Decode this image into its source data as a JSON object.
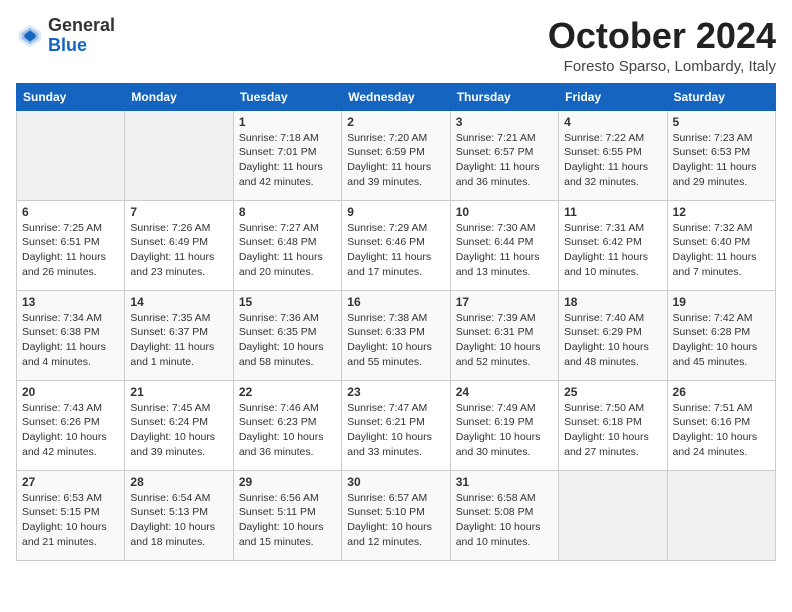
{
  "logo": {
    "general": "General",
    "blue": "Blue"
  },
  "title": "October 2024",
  "location": "Foresto Sparso, Lombardy, Italy",
  "days_header": [
    "Sunday",
    "Monday",
    "Tuesday",
    "Wednesday",
    "Thursday",
    "Friday",
    "Saturday"
  ],
  "weeks": [
    [
      {
        "day": "",
        "info": ""
      },
      {
        "day": "",
        "info": ""
      },
      {
        "day": "1",
        "info": "Sunrise: 7:18 AM\nSunset: 7:01 PM\nDaylight: 11 hours and 42 minutes."
      },
      {
        "day": "2",
        "info": "Sunrise: 7:20 AM\nSunset: 6:59 PM\nDaylight: 11 hours and 39 minutes."
      },
      {
        "day": "3",
        "info": "Sunrise: 7:21 AM\nSunset: 6:57 PM\nDaylight: 11 hours and 36 minutes."
      },
      {
        "day": "4",
        "info": "Sunrise: 7:22 AM\nSunset: 6:55 PM\nDaylight: 11 hours and 32 minutes."
      },
      {
        "day": "5",
        "info": "Sunrise: 7:23 AM\nSunset: 6:53 PM\nDaylight: 11 hours and 29 minutes."
      }
    ],
    [
      {
        "day": "6",
        "info": "Sunrise: 7:25 AM\nSunset: 6:51 PM\nDaylight: 11 hours and 26 minutes."
      },
      {
        "day": "7",
        "info": "Sunrise: 7:26 AM\nSunset: 6:49 PM\nDaylight: 11 hours and 23 minutes."
      },
      {
        "day": "8",
        "info": "Sunrise: 7:27 AM\nSunset: 6:48 PM\nDaylight: 11 hours and 20 minutes."
      },
      {
        "day": "9",
        "info": "Sunrise: 7:29 AM\nSunset: 6:46 PM\nDaylight: 11 hours and 17 minutes."
      },
      {
        "day": "10",
        "info": "Sunrise: 7:30 AM\nSunset: 6:44 PM\nDaylight: 11 hours and 13 minutes."
      },
      {
        "day": "11",
        "info": "Sunrise: 7:31 AM\nSunset: 6:42 PM\nDaylight: 11 hours and 10 minutes."
      },
      {
        "day": "12",
        "info": "Sunrise: 7:32 AM\nSunset: 6:40 PM\nDaylight: 11 hours and 7 minutes."
      }
    ],
    [
      {
        "day": "13",
        "info": "Sunrise: 7:34 AM\nSunset: 6:38 PM\nDaylight: 11 hours and 4 minutes."
      },
      {
        "day": "14",
        "info": "Sunrise: 7:35 AM\nSunset: 6:37 PM\nDaylight: 11 hours and 1 minute."
      },
      {
        "day": "15",
        "info": "Sunrise: 7:36 AM\nSunset: 6:35 PM\nDaylight: 10 hours and 58 minutes."
      },
      {
        "day": "16",
        "info": "Sunrise: 7:38 AM\nSunset: 6:33 PM\nDaylight: 10 hours and 55 minutes."
      },
      {
        "day": "17",
        "info": "Sunrise: 7:39 AM\nSunset: 6:31 PM\nDaylight: 10 hours and 52 minutes."
      },
      {
        "day": "18",
        "info": "Sunrise: 7:40 AM\nSunset: 6:29 PM\nDaylight: 10 hours and 48 minutes."
      },
      {
        "day": "19",
        "info": "Sunrise: 7:42 AM\nSunset: 6:28 PM\nDaylight: 10 hours and 45 minutes."
      }
    ],
    [
      {
        "day": "20",
        "info": "Sunrise: 7:43 AM\nSunset: 6:26 PM\nDaylight: 10 hours and 42 minutes."
      },
      {
        "day": "21",
        "info": "Sunrise: 7:45 AM\nSunset: 6:24 PM\nDaylight: 10 hours and 39 minutes."
      },
      {
        "day": "22",
        "info": "Sunrise: 7:46 AM\nSunset: 6:23 PM\nDaylight: 10 hours and 36 minutes."
      },
      {
        "day": "23",
        "info": "Sunrise: 7:47 AM\nSunset: 6:21 PM\nDaylight: 10 hours and 33 minutes."
      },
      {
        "day": "24",
        "info": "Sunrise: 7:49 AM\nSunset: 6:19 PM\nDaylight: 10 hours and 30 minutes."
      },
      {
        "day": "25",
        "info": "Sunrise: 7:50 AM\nSunset: 6:18 PM\nDaylight: 10 hours and 27 minutes."
      },
      {
        "day": "26",
        "info": "Sunrise: 7:51 AM\nSunset: 6:16 PM\nDaylight: 10 hours and 24 minutes."
      }
    ],
    [
      {
        "day": "27",
        "info": "Sunrise: 6:53 AM\nSunset: 5:15 PM\nDaylight: 10 hours and 21 minutes."
      },
      {
        "day": "28",
        "info": "Sunrise: 6:54 AM\nSunset: 5:13 PM\nDaylight: 10 hours and 18 minutes."
      },
      {
        "day": "29",
        "info": "Sunrise: 6:56 AM\nSunset: 5:11 PM\nDaylight: 10 hours and 15 minutes."
      },
      {
        "day": "30",
        "info": "Sunrise: 6:57 AM\nSunset: 5:10 PM\nDaylight: 10 hours and 12 minutes."
      },
      {
        "day": "31",
        "info": "Sunrise: 6:58 AM\nSunset: 5:08 PM\nDaylight: 10 hours and 10 minutes."
      },
      {
        "day": "",
        "info": ""
      },
      {
        "day": "",
        "info": ""
      }
    ]
  ]
}
